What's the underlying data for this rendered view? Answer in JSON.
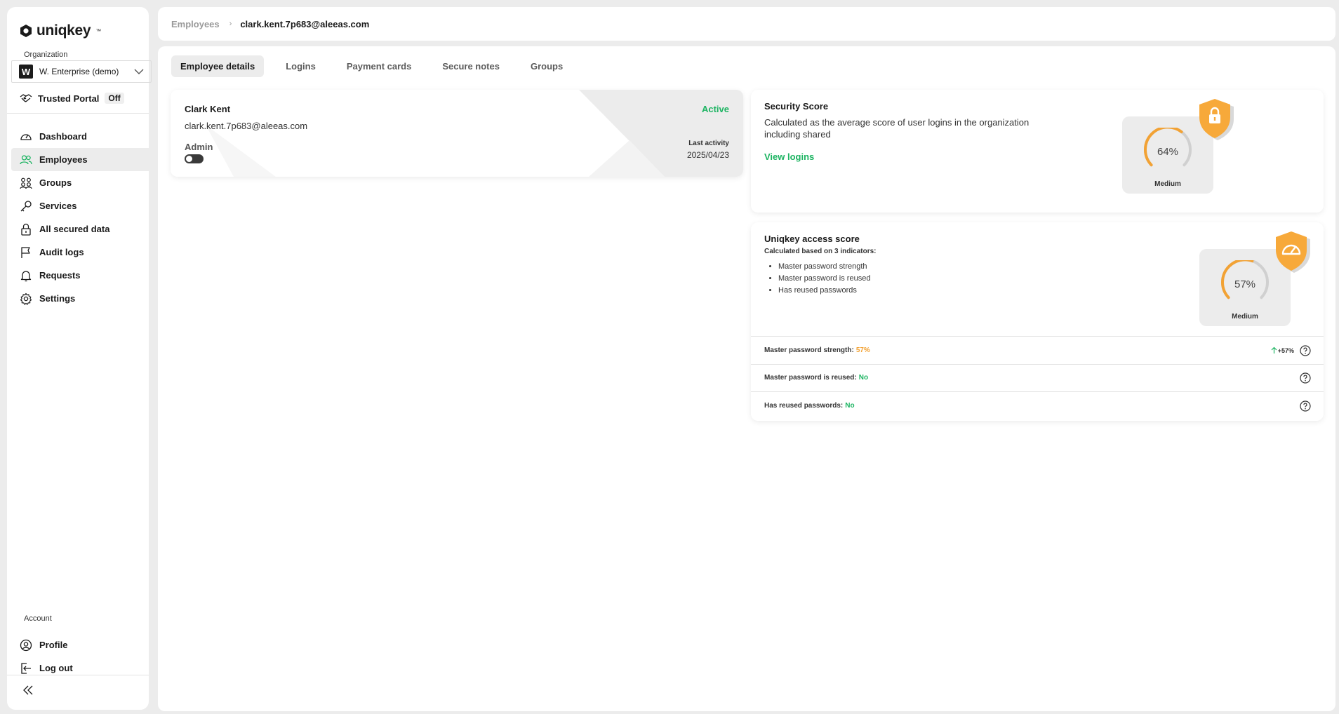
{
  "brand": {
    "name": "uniqkey",
    "tm": "™"
  },
  "sidebar": {
    "org_label": "Organization",
    "org_badge": "W",
    "org_name": "W. Enterprise (demo)",
    "trusted_portal": {
      "label": "Trusted Portal",
      "state": "Off"
    },
    "nav": [
      {
        "label": "Dashboard",
        "icon": "gauge-icon"
      },
      {
        "label": "Employees",
        "icon": "users-icon",
        "active": true
      },
      {
        "label": "Groups",
        "icon": "groups-icon"
      },
      {
        "label": "Services",
        "icon": "key-icon"
      },
      {
        "label": "All secured data",
        "icon": "lock-icon"
      },
      {
        "label": "Audit logs",
        "icon": "flag-icon"
      },
      {
        "label": "Requests",
        "icon": "bell-icon"
      },
      {
        "label": "Settings",
        "icon": "gear-icon"
      }
    ],
    "account_label": "Account",
    "account": [
      {
        "label": "Profile",
        "icon": "user-circle-icon"
      },
      {
        "label": "Log out",
        "icon": "logout-icon"
      }
    ]
  },
  "breadcrumb": {
    "parent": "Employees",
    "current": "clark.kent.7p683@aleeas.com"
  },
  "tabs": [
    {
      "label": "Employee details",
      "active": true
    },
    {
      "label": "Logins"
    },
    {
      "label": "Payment cards"
    },
    {
      "label": "Secure notes"
    },
    {
      "label": "Groups"
    }
  ],
  "employee": {
    "name": "Clark Kent",
    "email": "clark.kent.7p683@aleeas.com",
    "role": "Admin",
    "status": "Active",
    "last_activity_label": "Last activity",
    "last_activity": "2025/04/23"
  },
  "security_score": {
    "title": "Security Score",
    "description": "Calculated as the average score of user logins in the organization including shared",
    "link": "View logins",
    "value": "64%",
    "fraction": 0.64,
    "level": "Medium"
  },
  "access_score": {
    "title": "Uniqkey access score",
    "subtitle": "Calculated based on 3 indicators:",
    "indicators": [
      "Master password strength",
      "Master password is reused",
      "Has reused passwords"
    ],
    "value": "57%",
    "fraction": 0.57,
    "level": "Medium",
    "rows": [
      {
        "label": "Master password strength:",
        "value": "57%",
        "trend": "+57%"
      },
      {
        "label": "Master password is reused:",
        "value": "No"
      },
      {
        "label": "Has reused passwords:",
        "value": "No"
      }
    ]
  },
  "colors": {
    "accent_green": "#1db462",
    "accent_orange": "#f2a234",
    "shield": "#f7a93a"
  }
}
